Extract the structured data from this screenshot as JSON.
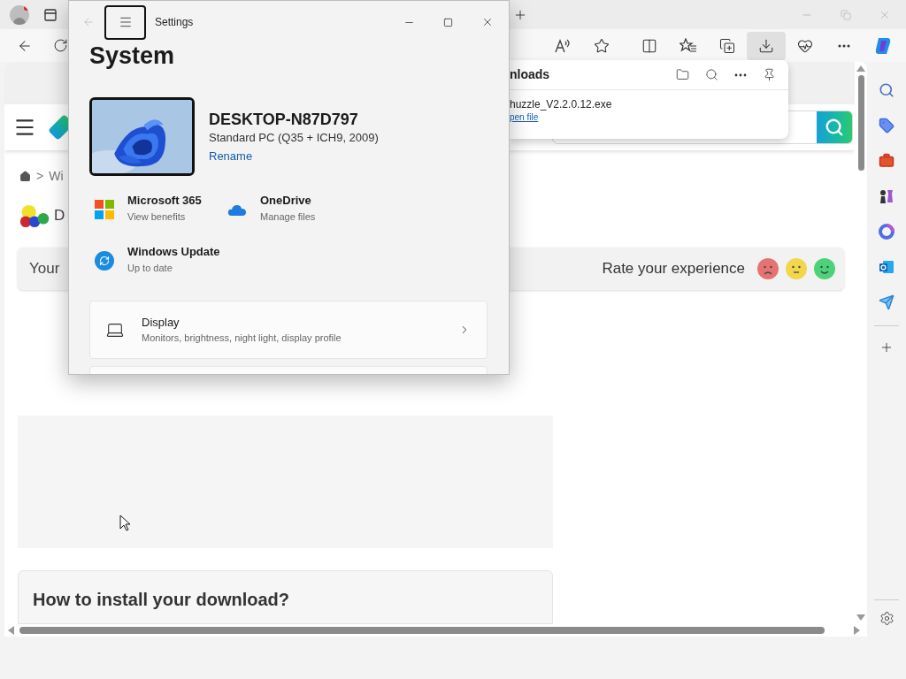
{
  "toolbar": {
    "items": [
      {
        "kind": "read-aloud",
        "selected": false
      },
      {
        "kind": "favorite",
        "selected": false
      },
      {
        "kind": "split",
        "selected": false
      },
      {
        "kind": "favorites",
        "selected": false
      },
      {
        "kind": "collections",
        "selected": false
      },
      {
        "kind": "downloads",
        "selected": true
      },
      {
        "kind": "health",
        "selected": false
      },
      {
        "kind": "more",
        "selected": false
      },
      {
        "kind": "copilot",
        "selected": false
      }
    ]
  },
  "page": {
    "breadcrumb": {
      "separator": ">",
      "current": "Wi"
    },
    "title_fragment": "D",
    "feedback": {
      "text": "Your",
      "prompt": "Rate your experience",
      "faces": [
        {
          "kind": "sad"
        },
        {
          "kind": "neutral"
        },
        {
          "kind": "happy"
        }
      ]
    },
    "install_card": {
      "title": "How to install your download?"
    }
  },
  "downloads_panel": {
    "title": "nloads",
    "files": [
      {
        "name": "huzzle_V2.2.0.12.exe",
        "action": "pen file"
      }
    ]
  },
  "sidebar": {
    "items": [
      {
        "kind": "search"
      },
      {
        "kind": "tag"
      },
      {
        "kind": "toolbox"
      },
      {
        "kind": "chess"
      },
      {
        "kind": "circle-app"
      },
      {
        "kind": "mail"
      },
      {
        "kind": "send"
      }
    ]
  },
  "settings_window": {
    "title": "Settings",
    "heading": "System",
    "device": {
      "name": "DESKTOP-N87D797",
      "model": "Standard PC (Q35 + ICH9, 2009)",
      "action": "Rename"
    },
    "quick_links": [
      {
        "kind": "microsoft365",
        "title": "Microsoft 365",
        "subtitle": "View benefits"
      },
      {
        "kind": "onedrive",
        "title": "OneDrive",
        "subtitle": "Manage files"
      },
      {
        "kind": "update",
        "title": "Windows Update",
        "subtitle": "Up to date"
      }
    ],
    "cards": [
      {
        "kind": "display",
        "title": "Display",
        "subtitle": "Monitors, brightness, night light, display profile"
      }
    ]
  }
}
